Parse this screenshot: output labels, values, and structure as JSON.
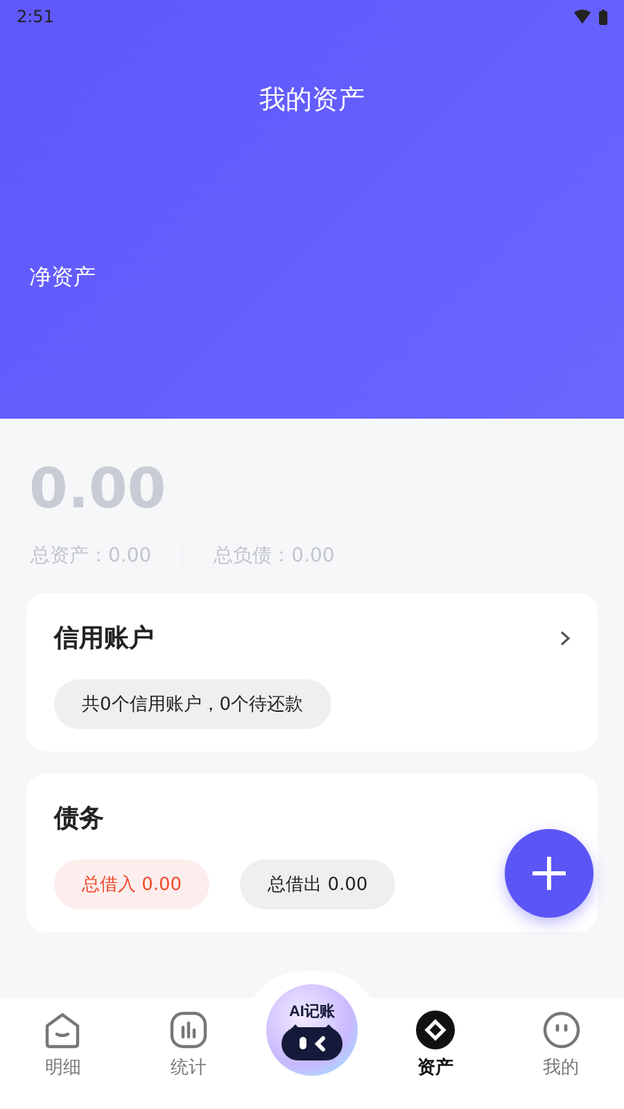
{
  "status_bar": {
    "time": "2:51"
  },
  "header": {
    "title": "我的资产",
    "net_label": "净资产"
  },
  "summary": {
    "net_value": "0.00",
    "total_assets": "总资产：0.00",
    "total_liabilities": "总负债：0.00"
  },
  "credit_card": {
    "title": "信用账户",
    "info": "共0个信用账户，0个待还款"
  },
  "debt_card": {
    "title": "债务",
    "borrowed_in": "总借入 0.00",
    "lent_out": "总借出 0.00"
  },
  "ai_button": {
    "label": "AI记账"
  },
  "tabs": [
    {
      "label": "明细",
      "kind": "home",
      "selected": false
    },
    {
      "label": "统计",
      "kind": "chart",
      "selected": false
    },
    {
      "label": "资产",
      "kind": "assets",
      "selected": true
    },
    {
      "label": "我的",
      "kind": "face",
      "selected": false
    }
  ]
}
